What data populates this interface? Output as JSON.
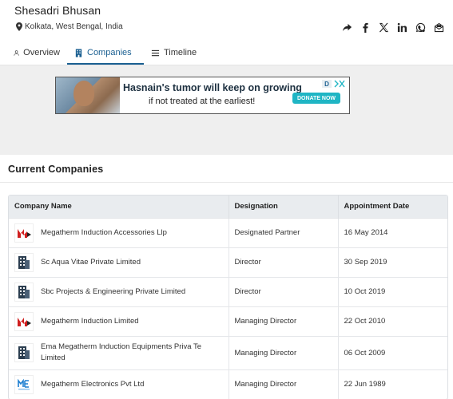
{
  "person": {
    "name": "Shesadri Bhusan",
    "location": "Kolkata, West Bengal, India"
  },
  "share_icons": [
    "share-icon",
    "facebook-icon",
    "x-icon",
    "linkedin-icon",
    "whatsapp-icon",
    "mail-icon"
  ],
  "tabs": [
    {
      "label": "Overview",
      "icon": "user-icon",
      "active": false
    },
    {
      "label": "Companies",
      "icon": "building-icon",
      "active": true
    },
    {
      "label": "Timeline",
      "icon": "list-icon",
      "active": false
    }
  ],
  "ad": {
    "line1": "Hasnain's tumor will keep on growing",
    "line2": "if not treated at the earliest!",
    "button": "DONATE NOW"
  },
  "section": {
    "title": "Current Companies"
  },
  "table": {
    "headers": [
      "Company Name",
      "Designation",
      "Appointment Date"
    ],
    "rows": [
      {
        "name": "Megatherm Induction Accessories Llp",
        "designation": "Designated Partner",
        "date": "16 May 2014",
        "logo": "megatherm-logo"
      },
      {
        "name": "Sc Aqua Vitae Private Limited",
        "designation": "Director",
        "date": "30 Sep 2019",
        "logo": "building-icon"
      },
      {
        "name": "Sbc Projects & Engineering Private Limited",
        "designation": "Director",
        "date": "10 Oct 2019",
        "logo": "building-icon"
      },
      {
        "name": "Megatherm Induction Limited",
        "designation": "Managing Director",
        "date": "22 Oct 2010",
        "logo": "megatherm-logo"
      },
      {
        "name": "Ema Megatherm Induction Equipments Priva Te Limited",
        "designation": "Managing Director",
        "date": "06 Oct 2009",
        "logo": "building-icon"
      },
      {
        "name": "Megatherm Electronics Pvt Ltd",
        "designation": "Managing Director",
        "date": "22 Jun 1989",
        "logo": "megatherm-electronics-logo"
      }
    ]
  },
  "colors": {
    "accent": "#1a5f91",
    "header_bg": "#e9ecef",
    "ad_area_bg": "#efefef",
    "donate_btn": "#1fb5c4",
    "megatherm_red": "#d01f1f"
  }
}
